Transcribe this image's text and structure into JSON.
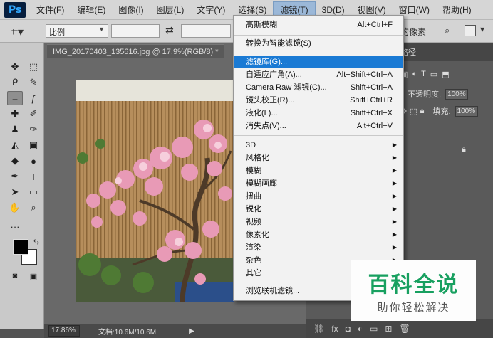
{
  "app": {
    "logo": "Ps"
  },
  "menubar": {
    "items": [
      "文件(F)",
      "编辑(E)",
      "图像(I)",
      "图层(L)",
      "文字(Y)",
      "选择(S)",
      "滤镜(T)",
      "3D(D)",
      "视图(V)",
      "窗口(W)",
      "帮助(H)"
    ],
    "active_index": 6
  },
  "options": {
    "ratio_value": "比例",
    "pixels_text": "的像素"
  },
  "document": {
    "tab_title": "IMG_20170403_135616.jpg @ 17.9%(RGB/8) *",
    "zoom": "17.86%",
    "doc_size": "文档:10.6M/10.6M"
  },
  "panels": {
    "tab_label": "路径",
    "opacity_label": "不透明度:",
    "opacity_value": "100%",
    "fill_label": "填充:",
    "fill_value": "100%"
  },
  "filter_menu": {
    "items": [
      {
        "label": "高斯模糊",
        "shortcut": "Alt+Ctrl+F"
      },
      {
        "label": "转换为智能滤镜(S)",
        "shortcut": ""
      },
      {
        "label": "滤镜库(G)...",
        "shortcut": ""
      },
      {
        "label": "自适应广角(A)...",
        "shortcut": "Alt+Shift+Ctrl+A"
      },
      {
        "label": "Camera Raw 滤镜(C)...",
        "shortcut": "Shift+Ctrl+A"
      },
      {
        "label": "镜头校正(R)...",
        "shortcut": "Shift+Ctrl+R"
      },
      {
        "label": "液化(L)...",
        "shortcut": "Shift+Ctrl+X"
      },
      {
        "label": "消失点(V)...",
        "shortcut": "Alt+Ctrl+V"
      },
      {
        "label": "3D",
        "shortcut": ""
      },
      {
        "label": "风格化",
        "shortcut": ""
      },
      {
        "label": "模糊",
        "shortcut": ""
      },
      {
        "label": "模糊画廊",
        "shortcut": ""
      },
      {
        "label": "扭曲",
        "shortcut": ""
      },
      {
        "label": "锐化",
        "shortcut": ""
      },
      {
        "label": "视频",
        "shortcut": ""
      },
      {
        "label": "像素化",
        "shortcut": ""
      },
      {
        "label": "渲染",
        "shortcut": ""
      },
      {
        "label": "杂色",
        "shortcut": ""
      },
      {
        "label": "其它",
        "shortcut": ""
      },
      {
        "label": "浏览联机滤镜...",
        "shortcut": ""
      }
    ],
    "highlighted_index": 2
  },
  "watermark": {
    "main": "百科全说",
    "sub": "助你轻松解决"
  },
  "colors": {
    "accent": "#1a7ad4",
    "watermark_green": "#18a060"
  }
}
